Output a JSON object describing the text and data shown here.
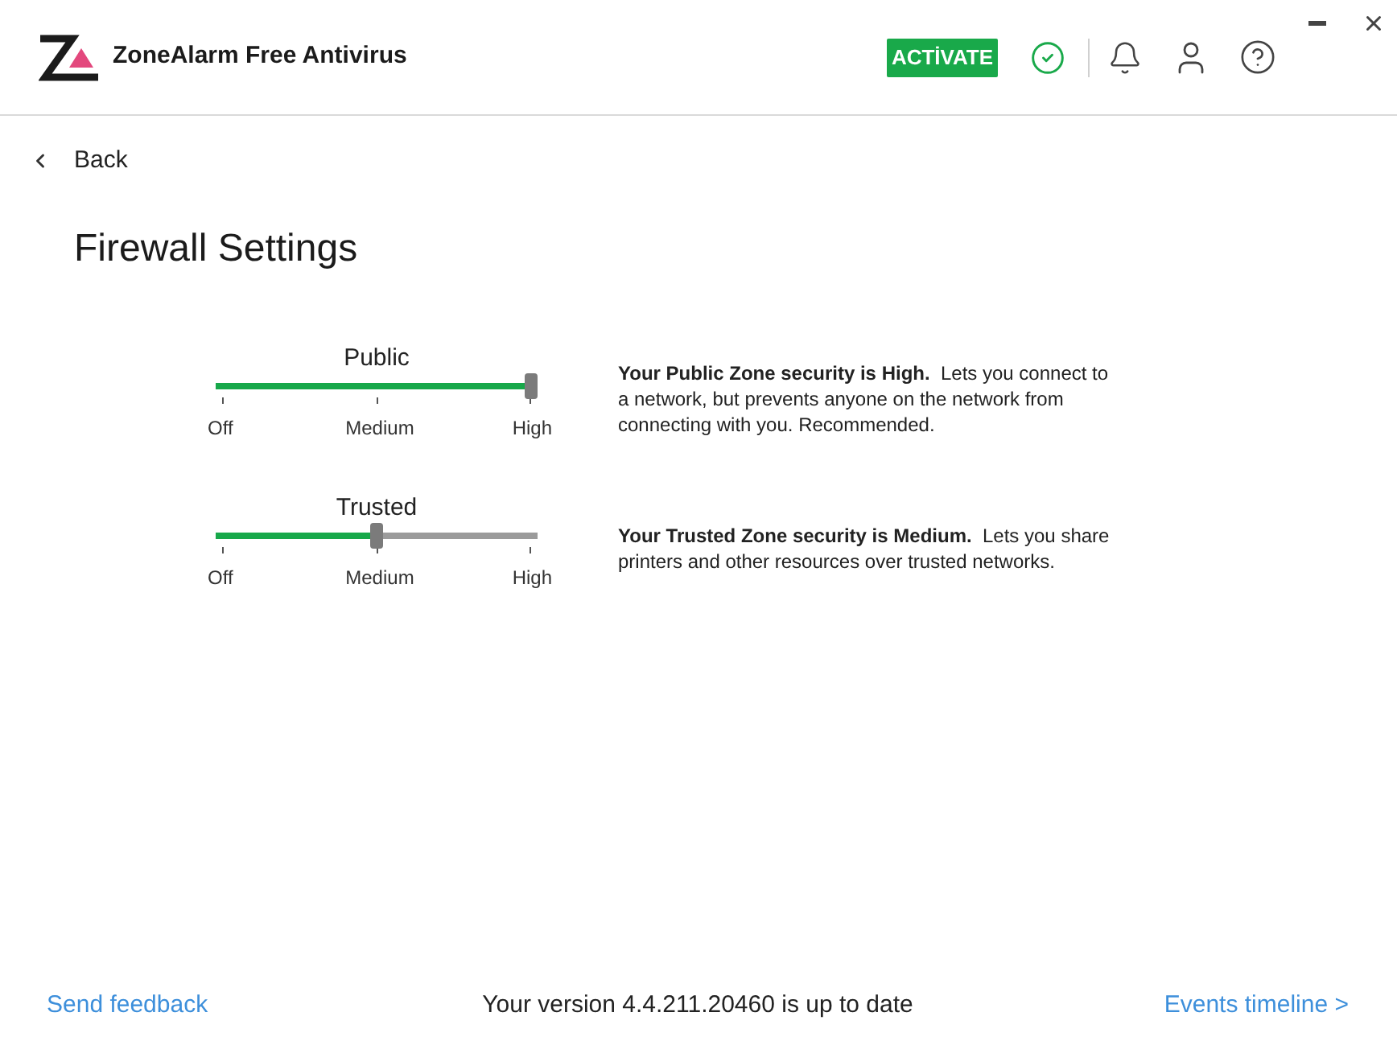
{
  "header": {
    "app_name": "ZoneAlarm Free Antivirus",
    "activate_button": "ACTİVATE"
  },
  "back_link": "Back",
  "page_title": "Firewall Settings",
  "zones": [
    {
      "name": "Public",
      "level": 1,
      "scale_labels": [
        "Off",
        "Medium",
        "High"
      ],
      "description": "**Your Public Zone security is High.**  Lets you connect to a network, but prevents anyone on the network from connecting with you. Recommended."
    },
    {
      "name": "Trusted",
      "level": 0.5,
      "scale_labels": [
        "Off",
        "Medium",
        "High"
      ],
      "description": "**Your Trusted Zone security is Medium.**  Lets you share printers and other resources over trusted networks."
    }
  ],
  "footer": {
    "feedback_link": "Send feedback",
    "version_status": "Your version 4.4.211.20460 is up to date",
    "timeline_link": "Events timeline >"
  }
}
